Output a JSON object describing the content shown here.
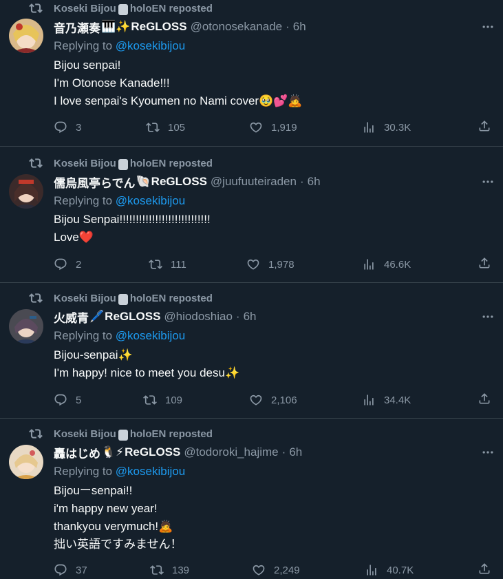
{
  "colors": {
    "background": "#15202b",
    "divider": "#38444d",
    "secondary_text": "#8b98a5",
    "link": "#1d9bf0",
    "primary_text": "#f7f9f9"
  },
  "tweets": [
    {
      "repost_by": "Koseki Bijou",
      "repost_suffix": "holoEN reposted",
      "display_name": "音乃瀬奏",
      "name_emoji": "🎹✨",
      "name_suffix": "ReGLOSS",
      "handle": "@otonosekanade",
      "time": "6h",
      "replying_label": "Replying to",
      "replying_to": "@kosekibijou",
      "lines": [
        "Bijou senpai!",
        "I'm Otonose Kanade!!!",
        "I love senpai's Kyoumen no Nami cover🥹💕🙇"
      ],
      "replies": "3",
      "reposts": "105",
      "likes": "1,919",
      "views": "30.3K"
    },
    {
      "repost_by": "Koseki Bijou",
      "repost_suffix": "holoEN reposted",
      "display_name": "儒烏風亭らでん",
      "name_emoji": "🐚",
      "name_suffix": "ReGLOSS",
      "handle": "@juufuuteiraden",
      "time": "6h",
      "replying_label": "Replying to",
      "replying_to": "@kosekibijou",
      "lines": [
        "Bijou Senpai!!!!!!!!!!!!!!!!!!!!!!!!!!!!",
        "Love❤️"
      ],
      "replies": "2",
      "reposts": "111",
      "likes": "1,978",
      "views": "46.6K"
    },
    {
      "repost_by": "Koseki Bijou",
      "repost_suffix": "holoEN reposted",
      "display_name": "火威青",
      "name_emoji": "🖊️",
      "name_suffix": "ReGLOSS",
      "handle": "@hiodoshiao",
      "time": "6h",
      "replying_label": "Replying to",
      "replying_to": "@kosekibijou",
      "lines": [
        "Bijou-senpai✨",
        "I'm happy! nice to meet you desu✨"
      ],
      "replies": "5",
      "reposts": "109",
      "likes": "2,106",
      "views": "34.4K"
    },
    {
      "repost_by": "Koseki Bijou",
      "repost_suffix": "holoEN reposted",
      "display_name": "轟はじめ",
      "name_emoji": "🐧⚡",
      "name_suffix": "ReGLOSS",
      "handle": "@todoroki_hajime",
      "time": "6h",
      "replying_label": "Replying to",
      "replying_to": "@kosekibijou",
      "lines": [
        "Bijouーsenpai!!",
        "i'm happy new year!",
        "thankyou verymuch!🙇",
        "拙い英語ですみません！"
      ],
      "replies": "37",
      "reposts": "139",
      "likes": "2,249",
      "views": "40.7K"
    }
  ],
  "icons": {
    "repost": "repost-icon",
    "reply": "reply-icon",
    "like": "heart-icon",
    "views": "views-chart-icon",
    "share": "share-icon",
    "more": "more-dots-icon"
  }
}
